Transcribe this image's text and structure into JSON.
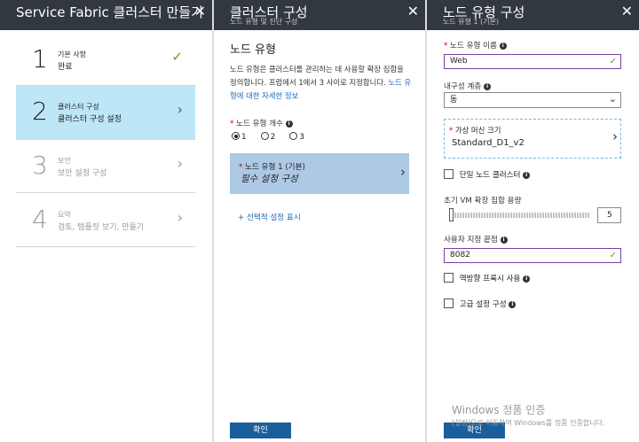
{
  "blade1": {
    "title": "Service Fabric 클러스터 만들기",
    "steps": [
      {
        "number": "1",
        "title": "기본 사항",
        "desc": "완료",
        "state": "done"
      },
      {
        "number": "2",
        "title": "클러스터 구성",
        "desc": "클러스터 구성 설정",
        "state": "active"
      },
      {
        "number": "3",
        "title": "보안",
        "desc": "보안 설정 구성",
        "state": "disabled"
      },
      {
        "number": "4",
        "title": "요약",
        "desc": "검토, 템플릿 보기, 만들기",
        "state": "disabled"
      }
    ]
  },
  "blade2": {
    "title": "클러스터 구성",
    "subtitle": "노드 유형 및 진단 구성",
    "section_title": "노드 유형",
    "description": "노드 유형은 클러스터를 관리하는 데 사용할 확장 집합을 정의합니다. 프럼에서 1에서 3 사이로 지정합니다.",
    "learn_more": "노드 유형에 대한 자세한 정보",
    "node_count_label": "노드 유형 개수",
    "node_count_options": [
      "1",
      "2",
      "3"
    ],
    "node_count_selected": "1",
    "node_type_title": "노드 유형 1 (기본)",
    "node_type_desc": "필수 설정 구성",
    "show_optional": "+ 선택적 설정 표시",
    "ok_label": "확인"
  },
  "blade3": {
    "title": "노드 유형 구성",
    "subtitle": "노드 유형 1 (기본)",
    "name_label": "노드 유형 이름",
    "name_value": "Web",
    "durability_label": "내구성 계층",
    "durability_value": "동",
    "vm_size_label": "가상 머신 크기",
    "vm_size_value": "Standard_D1_v2",
    "single_node_label": "단일 노드 클러스터",
    "vm_capacity_label": "초기 VM 확장 집합 용량",
    "vm_capacity_value": "5",
    "vm_capacity_fraction": 0.0,
    "custom_endpoint_label": "사용자 지정 끝점",
    "custom_endpoint_value": "8082",
    "reverse_proxy_label": "역방향 프록시 사용",
    "advanced_label": "고급 설정 구성",
    "ok_label": "확인"
  },
  "watermark": {
    "line1": "Windows 정품 인증",
    "line2": "[설정]으로 이동하여 Windows를 정품 인증합니다."
  },
  "icons": {
    "close": "close-icon",
    "check": "checkmark-icon",
    "chevron": "chevron-right-icon",
    "info": "info-icon",
    "caret": "chevron-down-icon"
  },
  "colors": {
    "header_bg": "#32383f",
    "active_step_bg": "#bde7f7",
    "selected_row_bg": "#adc9e6",
    "primary_button": "#1b5e9c",
    "link": "#1a6ab8",
    "valid_check": "#5aa02c",
    "required_star": "#c00000"
  }
}
